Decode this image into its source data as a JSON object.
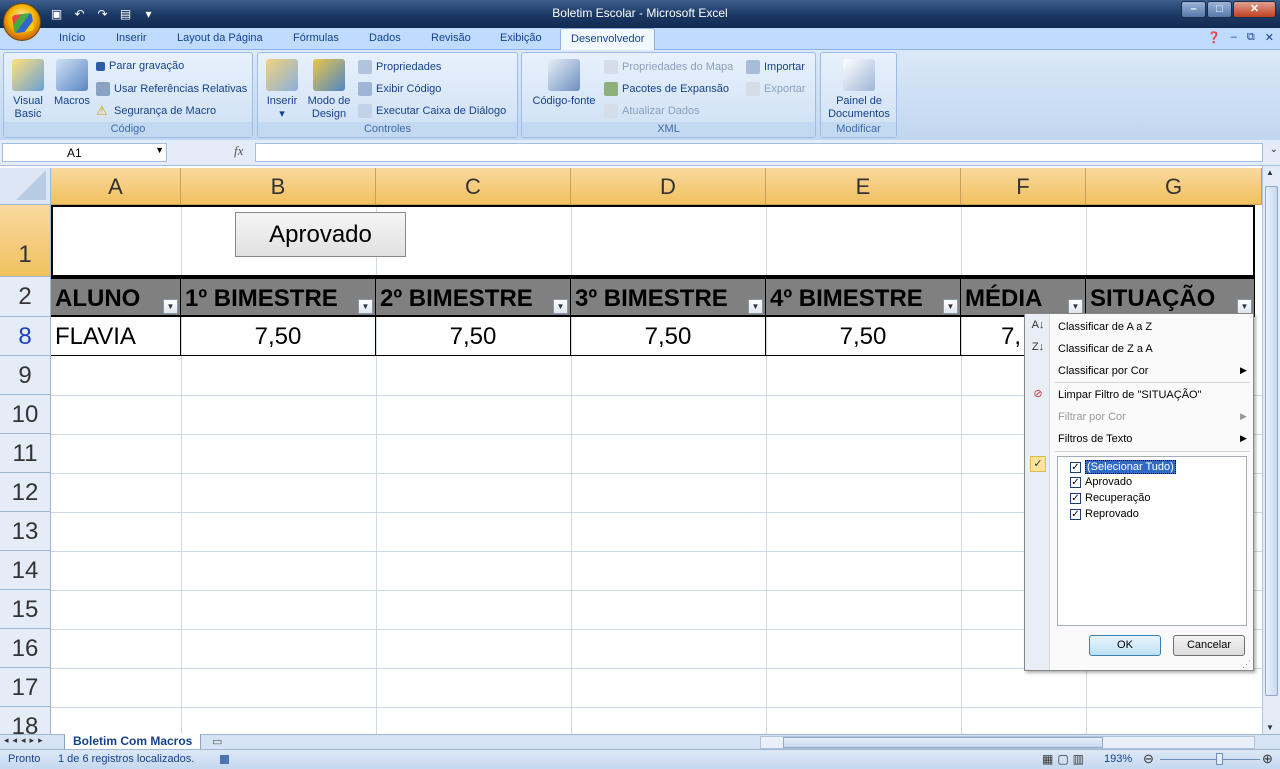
{
  "window": {
    "title": "Boletim Escolar - Microsoft Excel"
  },
  "ribbon_tabs": [
    "Início",
    "Inserir",
    "Layout da Página",
    "Fórmulas",
    "Dados",
    "Revisão",
    "Exibição",
    "Desenvolvedor"
  ],
  "active_tab": "Desenvolvedor",
  "ribbon": {
    "codigo": {
      "label": "Código",
      "visual_basic": "Visual Basic",
      "macros": "Macros",
      "parar_gravacao": "Parar gravação",
      "usar_referencias": "Usar Referências Relativas",
      "seguranca": "Segurança de Macro"
    },
    "controles": {
      "label": "Controles",
      "inserir": "Inserir",
      "modo_design": "Modo de Design",
      "propriedades": "Propriedades",
      "exibir_codigo": "Exibir Código",
      "executar_caixa": "Executar Caixa de Diálogo"
    },
    "xml": {
      "label": "XML",
      "codigo_fonte": "Código-fonte",
      "propriedades_mapa": "Propriedades do Mapa",
      "pacotes": "Pacotes de Expansão",
      "atualizar": "Atualizar Dados",
      "importar": "Importar",
      "exportar": "Exportar"
    },
    "modificar": {
      "label": "Modificar",
      "painel": "Painel de Documentos"
    }
  },
  "formula_bar": {
    "name_box": "A1",
    "fx": "fx",
    "formula": ""
  },
  "columns": [
    "A",
    "B",
    "C",
    "D",
    "E",
    "F",
    "G"
  ],
  "rows": [
    "1",
    "2",
    "8",
    "9",
    "10",
    "11",
    "12",
    "13",
    "14",
    "15",
    "16",
    "17",
    "18"
  ],
  "sheet_button": "Aprovado",
  "headers": [
    "ALUNO",
    "1º BIMESTRE",
    "2º BIMESTRE",
    "3º BIMESTRE",
    "4º BIMESTRE",
    "MÉDIA",
    "SITUAÇÃO"
  ],
  "data_row": [
    "FLAVIA",
    "7,50",
    "7,50",
    "7,50",
    "7,50",
    "7,"
  ],
  "filter_menu": {
    "sort_az": "Classificar de A a Z",
    "sort_za": "Classificar de Z a A",
    "sort_color": "Classificar por Cor",
    "clear_filter": "Limpar Filtro de \"SITUAÇÃO\"",
    "filter_color": "Filtrar por Cor",
    "text_filters": "Filtros de Texto",
    "items": [
      "(Selecionar Tudo)",
      "Aprovado",
      "Recuperação",
      "Reprovado"
    ],
    "ok": "OK",
    "cancel": "Cancelar"
  },
  "sheet_tab": "Boletim Com Macros",
  "status": {
    "ready": "Pronto",
    "records": "1 de 6 registros localizados.",
    "zoom": "193%"
  }
}
